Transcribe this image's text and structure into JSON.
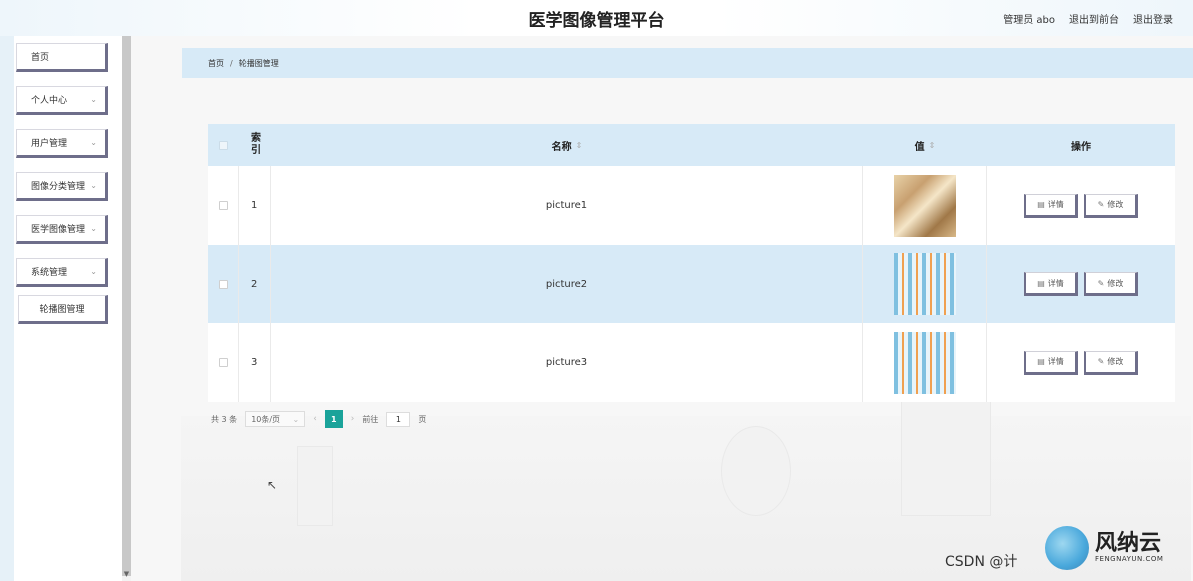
{
  "header": {
    "title": "医学图像管理平台",
    "user": "管理员 abo",
    "back_to_front": "退出到前台",
    "logout": "退出登录"
  },
  "sidebar": {
    "items": [
      {
        "label": "首页"
      },
      {
        "label": "个人中心"
      },
      {
        "label": "用户管理"
      },
      {
        "label": "图像分类管理"
      },
      {
        "label": "医学图像管理"
      },
      {
        "label": "系统管理"
      }
    ],
    "subitem": {
      "label": "轮播图管理"
    }
  },
  "breadcrumb": {
    "home": "首页",
    "separator": "/",
    "current": "轮播图管理"
  },
  "table": {
    "headers": {
      "index": "索引",
      "name": "名称",
      "value": "值",
      "ops": "操作"
    },
    "rows": [
      {
        "index": "1",
        "name": "picture1",
        "thumb": "room-photo"
      },
      {
        "index": "2",
        "name": "picture2",
        "thumb": "wave-pattern"
      },
      {
        "index": "3",
        "name": "picture3",
        "thumb": "wave-pattern"
      }
    ],
    "detail_label": "详情",
    "edit_label": "修改"
  },
  "pagination": {
    "total": "共 3 条",
    "page_size": "10条/页",
    "current_page": "1",
    "goto_label": "前往",
    "goto_value": "1",
    "page_suffix": "页"
  },
  "watermark": {
    "csdn": "CSDN @计",
    "logo_cn": "风纳云",
    "logo_en": "FENGNAYUN.COM"
  },
  "icons": {
    "sort": "sort-icon",
    "detail": "document-icon",
    "edit": "pencil-icon",
    "chevron": "chevron-down-icon"
  },
  "colors": {
    "accent": "#1aa39a",
    "header_bg": "#d7eaf7",
    "button_border": "#6e6e8a"
  }
}
